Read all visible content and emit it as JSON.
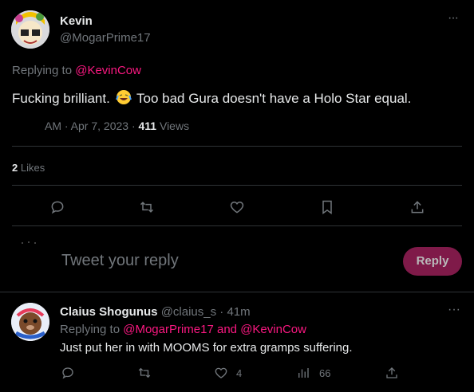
{
  "main_tweet": {
    "author_name": "Kevin",
    "author_handle": "@MogarPrime17",
    "replying_prefix": "Replying to ",
    "replying_to": "@KevinCow",
    "text_before_emoji": "Fucking brilliant.",
    "text_after_emoji": "Too bad Gura doesn't have a Holo Star equal.",
    "time_date": "AM · Apr 7, 2023 ·",
    "views_count": "411",
    "views_label": "Views",
    "likes_count": "2",
    "likes_label": "Likes"
  },
  "composer": {
    "placeholder": "Tweet your reply",
    "button_label": "Reply"
  },
  "reply_tweet": {
    "author_name": "Claius Shogunus",
    "author_handle": "@claius_s",
    "separator": "·",
    "time": "41m",
    "replying_prefix": "Replying to ",
    "replying_to_1": "@MogarPrime17",
    "replying_and": " and ",
    "replying_to_2": "@KevinCow",
    "text": "Just put her in with MOOMS for extra gramps suffering.",
    "like_count": "4",
    "view_count": "66"
  },
  "more_label": "···",
  "colors": {
    "accent": "#f91880",
    "muted": "#71767b",
    "reply_button": "#7f1a49",
    "divider": "#2f3336"
  }
}
